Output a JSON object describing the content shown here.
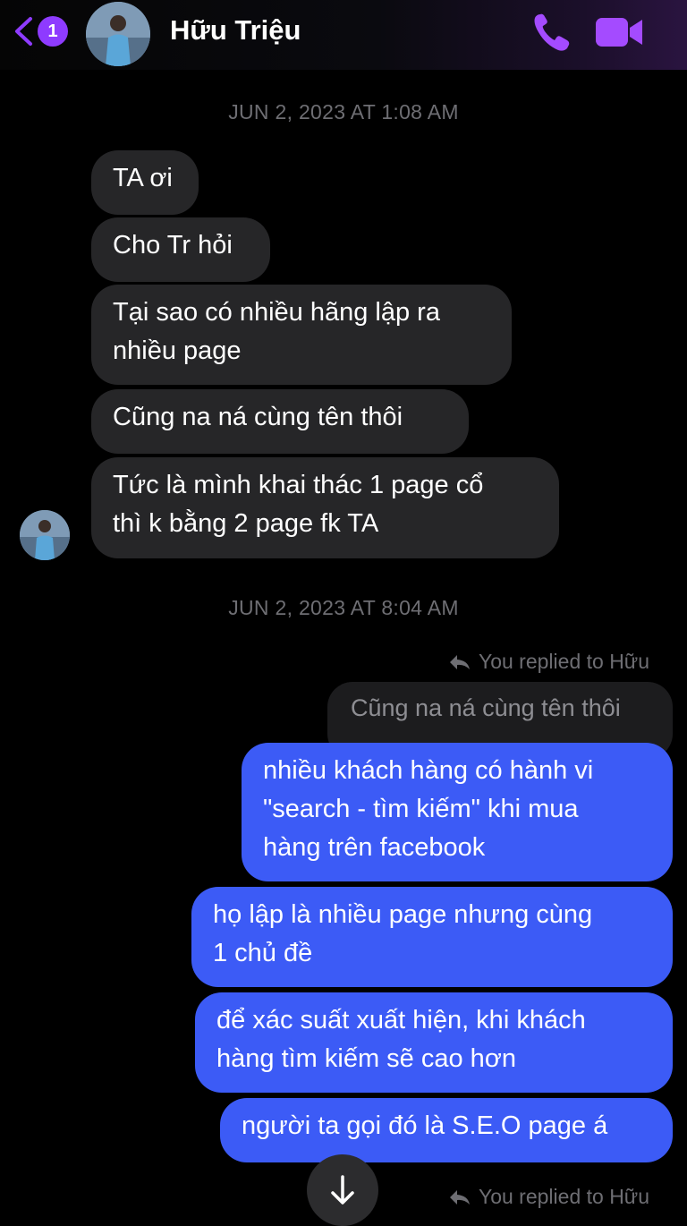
{
  "header": {
    "back_badge": "1",
    "contact_name": "Hữu Triệu",
    "accent_color": "#8e3bff"
  },
  "timestamps": [
    "JUN 2, 2023 AT 1:08 AM",
    "JUN 2, 2023 AT 8:04 AM"
  ],
  "incoming": [
    "TA ơi",
    "Cho Tr hỏi",
    "Tại sao có nhiều hãng lập ra\nnhiều page",
    "Cũng na ná cùng tên thôi",
    "Tức là mình khai thác 1 page cổ\nthì k bằng 2 page fk TA"
  ],
  "reply": {
    "note": "You replied to Hữu",
    "quoted": "Cũng na ná cùng tên thôi"
  },
  "outgoing": [
    "nhiều khách hàng có hành vi\n\"search - tìm kiếm\" khi mua\nhàng trên facebook",
    "họ lập là nhiều page nhưng cùng\n1 chủ đề",
    "để xác suất xuất hiện, khi khách\nhàng tìm kiếm sẽ cao hơn",
    "người ta gọi đó là S.E.O page á"
  ],
  "reply_note_2": "You replied to Hữu",
  "colors": {
    "incoming_bubble": "#262628",
    "outgoing_bubble": "#3c5bf6",
    "background": "#000000"
  }
}
